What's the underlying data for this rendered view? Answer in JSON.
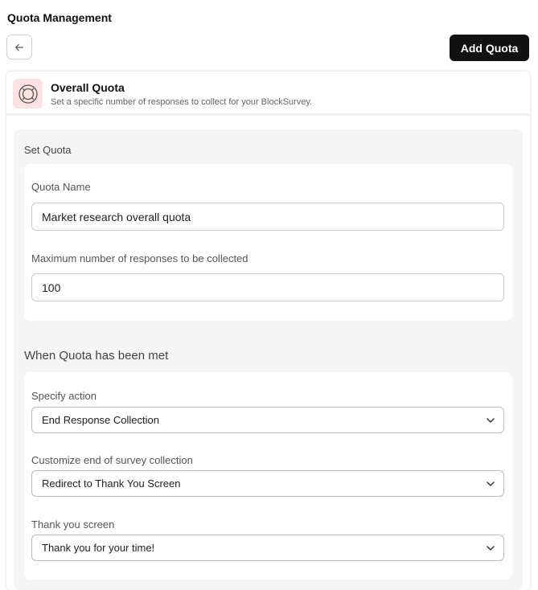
{
  "page": {
    "title": "Quota Management"
  },
  "toolbar": {
    "back_icon": "arrow-left-icon",
    "add_label": "Add Quota"
  },
  "card": {
    "icon": "target-icon",
    "title": "Overall Quota",
    "subtitle": "Set a specific number of responses to collect for your BlockSurvey."
  },
  "set_quota": {
    "label": "Set Quota",
    "name_label": "Quota Name",
    "name_value": "Market research overall quota",
    "max_label": "Maximum number of responses to be collected",
    "max_value": "100"
  },
  "when_met": {
    "heading": "When Quota has been met",
    "action_label": "Specify action",
    "action_value": "End Response Collection",
    "customize_label": "Customize end of survey collection",
    "customize_value": "Redirect to Thank You Screen",
    "thankyou_label": "Thank you screen",
    "thankyou_value": "Thank you for your time!"
  },
  "colors": {
    "primary_button": "#111111",
    "icon_bg": "#fde3e0"
  }
}
